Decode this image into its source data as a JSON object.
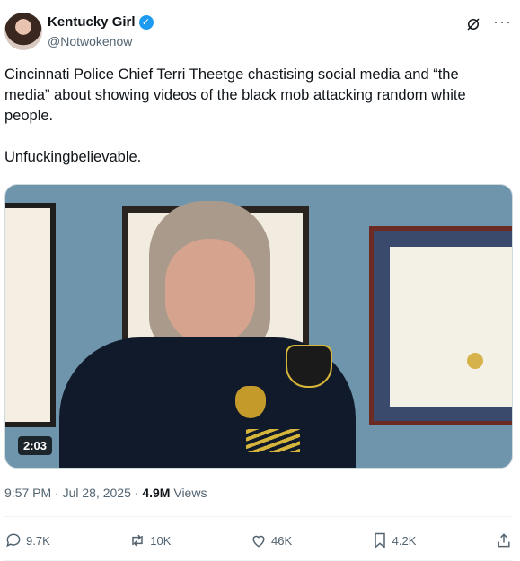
{
  "author": {
    "name": "Kentucky Girl",
    "handle": "@Notwokenow"
  },
  "tweet": {
    "paragraphs": [
      "Cincinnati Police Chief Terri Theetge chastising social media and “the media” about showing videos of the black mob attacking random white people.",
      "Unfuckingbelievable."
    ]
  },
  "media": {
    "duration": "2:03"
  },
  "meta": {
    "time": "9:57 PM",
    "separator": " · ",
    "date": "Jul 28, 2025",
    "views_count": "4.9M",
    "views_label": "Views"
  },
  "actions": {
    "replies": "9.7K",
    "reposts": "10K",
    "likes": "46K",
    "bookmarks": "4.2K"
  },
  "icons": {
    "verified": "verified-badge-icon",
    "grok": "grok-icon",
    "more": "more-icon",
    "reply": "reply-icon",
    "repost": "repost-icon",
    "like": "heart-icon",
    "bookmark": "bookmark-icon",
    "share": "share-icon"
  },
  "colors": {
    "accent": "#1d9bf0",
    "secondary_text": "#536471"
  }
}
